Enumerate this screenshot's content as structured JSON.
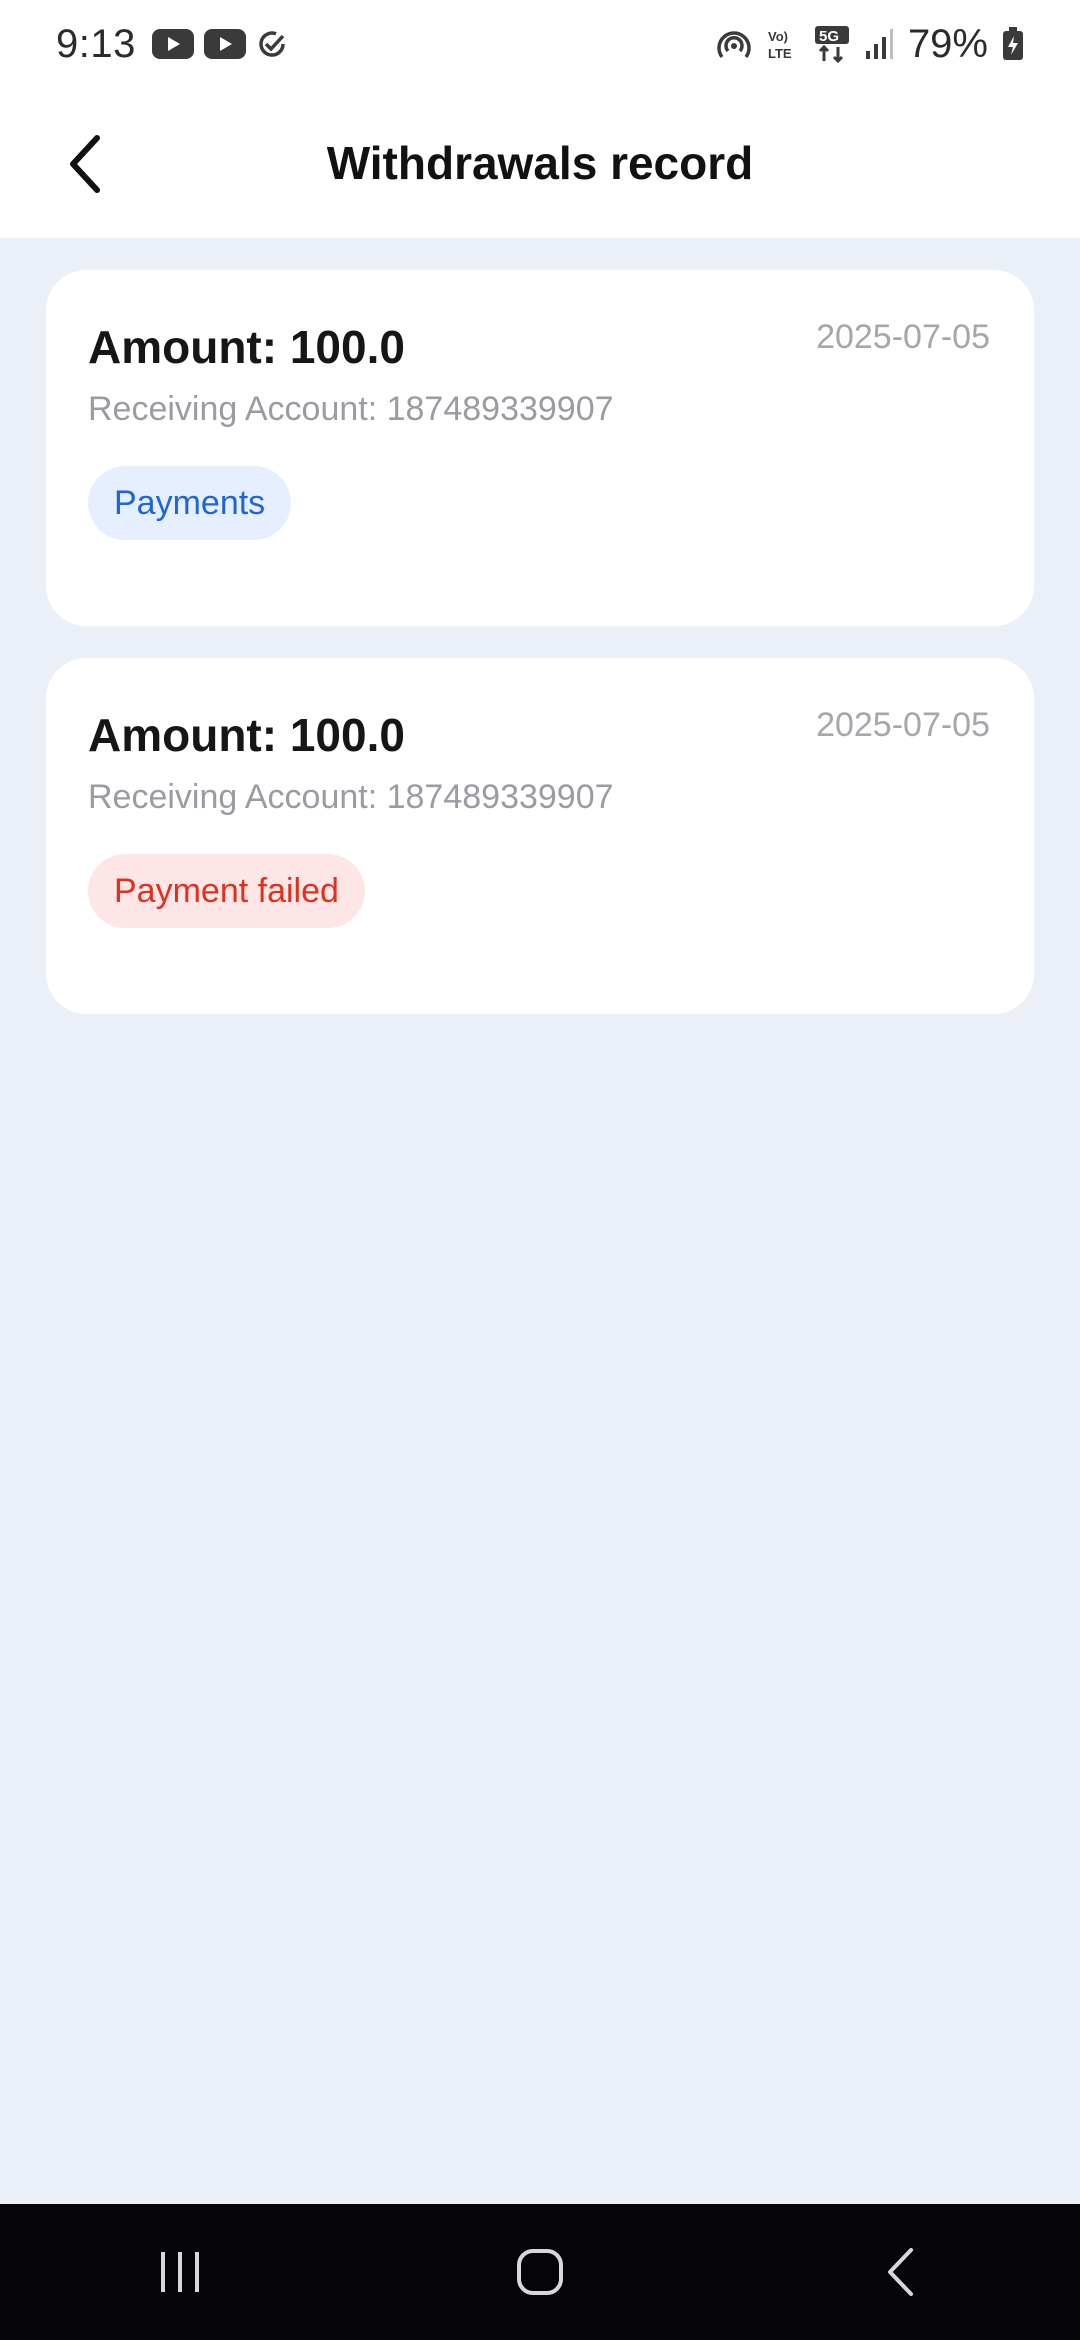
{
  "status_bar": {
    "time": "9:13",
    "battery": "79%",
    "icons_left": [
      "youtube-icon",
      "youtube-icon",
      "check-circle-icon"
    ],
    "icons_right": [
      "hotspot-icon",
      "volte-icon",
      "5g-icon",
      "signal-icon",
      "battery-charging-icon"
    ]
  },
  "header": {
    "title": "Withdrawals record",
    "back_icon": "back-arrow-icon"
  },
  "records": [
    {
      "amount": "Amount: 100.0",
      "date": "2025-07-05",
      "account": "Receiving Account: 187489339907",
      "status": "Payments",
      "status_color": "#1e66d6"
    },
    {
      "amount": "Amount: 100.0",
      "date": "2025-07-05",
      "account": "Receiving Account: 187489339907",
      "status": "Payment failed",
      "status_color": "#e0301e"
    }
  ],
  "colors": {
    "background": "#ebeff7",
    "card": "#ffffff",
    "info_badge_bg": "#e6efff",
    "error_badge_bg": "#ffe6e6"
  },
  "nav_bar": {
    "buttons": [
      "recent-apps-icon",
      "home-icon",
      "back-icon"
    ]
  }
}
